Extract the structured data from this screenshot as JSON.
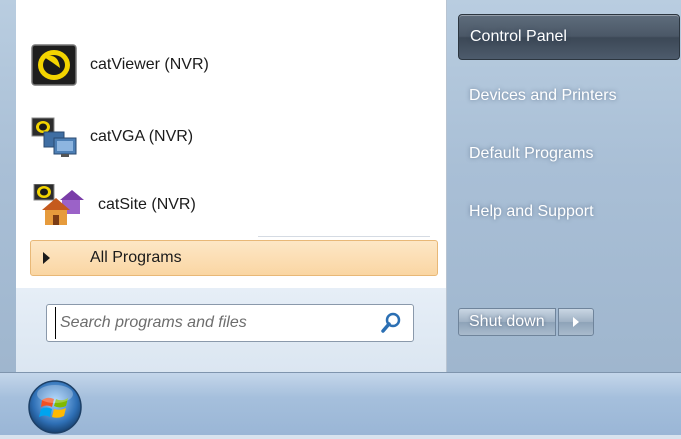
{
  "programs": [
    {
      "label": "catViewer (NVR)",
      "icon": "cat-viewer-icon"
    },
    {
      "label": "catVGA (NVR)",
      "icon": "cat-vga-icon"
    },
    {
      "label": "catSite (NVR)",
      "icon": "cat-site-icon"
    }
  ],
  "all_programs": {
    "label": "All Programs",
    "icon": "right-arrow-icon"
  },
  "search": {
    "placeholder": "Search programs and files",
    "value": "",
    "icon": "magnifier-icon"
  },
  "right_menu": [
    {
      "label": "Control Panel",
      "highlighted": true
    },
    {
      "label": "Devices and Printers"
    },
    {
      "label": "Default Programs"
    },
    {
      "label": "Help and Support"
    }
  ],
  "shutdown": {
    "label": "Shut down",
    "more_icon": "arrow-right-icon"
  },
  "taskbar": {
    "start_icon": "windows-orb-icon"
  },
  "colors": {
    "highlight": "#fad6a3",
    "glass": "#a9bfd6",
    "selected": "#4b5867"
  }
}
